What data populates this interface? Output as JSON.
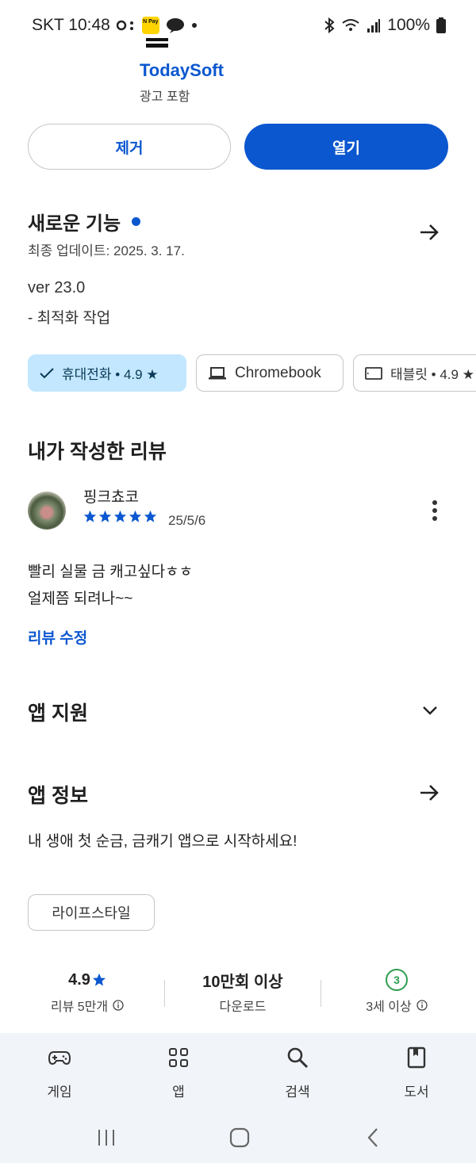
{
  "status_bar": {
    "carrier_time": "SKT 10:48",
    "pay_badge": "N Pay",
    "battery": "100%",
    "icons": [
      "chat-bubble-icon",
      "dot-icon",
      "bluetooth-icon",
      "wifi-icon",
      "signal-icon",
      "battery-icon"
    ]
  },
  "app": {
    "developer": "TodaySoft",
    "ads_label": "광고 포함",
    "uninstall_label": "제거",
    "open_label": "열기"
  },
  "whats_new": {
    "title": "새로운 기능",
    "updated": "최종 업데이트: 2025. 3. 17.",
    "version": "ver 23.0",
    "note": "- 최적화 작업"
  },
  "device_chips": {
    "phone": "휴대전화 • 4.9 ★",
    "chromebook": "Chromebook",
    "tablet": "태블릿 • 4.9 ★"
  },
  "my_review": {
    "title": "내가 작성한 리뷰",
    "reviewer": "핑크쵸코",
    "rating": 5,
    "date": "25/5/6",
    "lines": [
      "빨리 실물 금 캐고싶다ㅎㅎ",
      "얼제쯤 되려나~~"
    ],
    "edit_label": "리뷰 수정"
  },
  "app_support": {
    "title": "앱 지원"
  },
  "app_info": {
    "title": "앱 정보",
    "description": "내 생애 첫 순금, 금캐기 앱으로 시작하세요!",
    "category": "라이프스타일"
  },
  "stats": {
    "rating_value": "4.9",
    "rating_label": "리뷰 5만개",
    "downloads_value": "10만회 이상",
    "downloads_label": "다운로드",
    "age_badge": "3",
    "age_label": "3세 이상"
  },
  "bottom_nav": {
    "games": "게임",
    "apps": "앱",
    "search": "검색",
    "books": "도서"
  },
  "colors": {
    "accent": "#0b57d0",
    "chip_selected": "#c2e7ff",
    "age_green": "#2e9e4f",
    "nav_background": "#f1f4f9"
  }
}
